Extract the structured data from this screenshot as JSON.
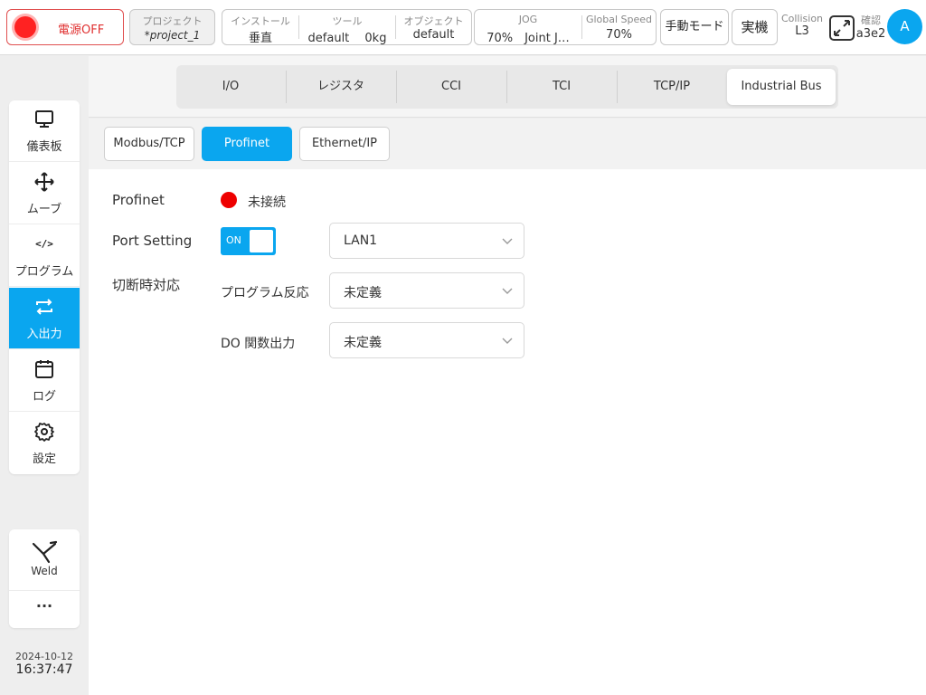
{
  "topbar": {
    "power_label": "電源OFF",
    "project": {
      "title": "プロジェクト",
      "value": "*project_1"
    },
    "install": {
      "title": "インストール",
      "value": "垂直"
    },
    "tool": {
      "title": "ツール",
      "value": "default　 0kg"
    },
    "object": {
      "title": "オブジェクト",
      "value": "default"
    },
    "jog": {
      "title": "JOG",
      "value": "70%　Joint J…"
    },
    "global_speed": {
      "title": "Global Speed",
      "value": "70%"
    },
    "manual_mode": "手動モード",
    "real_machine": "実機",
    "collision": {
      "title": "Collision",
      "value": "L3"
    },
    "confirm": {
      "title": "確認",
      "value": "a3e2"
    },
    "avatar": "A"
  },
  "sidenav": {
    "items": [
      {
        "label": "儀表板",
        "icon": "monitor-icon"
      },
      {
        "label": "ムーブ",
        "icon": "move-icon"
      },
      {
        "label": "プログラム",
        "icon": "code-icon",
        "glyph": "</>"
      },
      {
        "label": "入出力",
        "icon": "io-swap-icon"
      },
      {
        "label": "ログ",
        "icon": "calendar-icon"
      },
      {
        "label": "設定",
        "icon": "gear-icon"
      }
    ],
    "weld_label": "Weld",
    "more_label": "···"
  },
  "datetime": {
    "date": "2024-10-12",
    "time": "16:37:47"
  },
  "tabs": [
    "I/O",
    "レジスタ",
    "CCI",
    "TCI",
    "TCP/IP",
    "Industrial Bus"
  ],
  "subtabs": [
    "Modbus/TCP",
    "Profinet",
    "Ethernet/IP"
  ],
  "profinet": {
    "label": "Profinet",
    "status": "未接続",
    "port_setting_label": "Port Setting",
    "toggle_label": "ON",
    "port_value": "LAN1",
    "disconnect_label": "切断時対応",
    "program_reaction_label": "プログラム反応",
    "program_reaction_value": "未定義",
    "do_output_label": "DO 関数出力",
    "do_output_value": "未定義"
  },
  "colors": {
    "accent": "#0aa6ef",
    "error": "#ee0000"
  }
}
